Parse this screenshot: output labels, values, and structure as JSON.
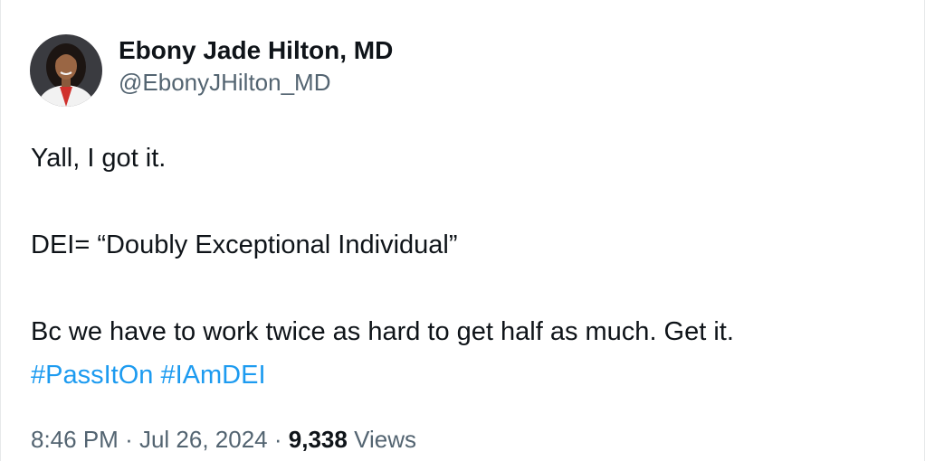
{
  "author": {
    "display_name": "Ebony Jade Hilton, MD",
    "handle": "@EbonyJHilton_MD"
  },
  "tweet": {
    "lines": [
      "Yall, I got it.",
      "DEI= “Doubly Exceptional Individual”",
      "Bc we have to work twice as hard to get half as much. Get it."
    ],
    "hashtags": [
      "#PassItOn",
      "#IAmDEI"
    ]
  },
  "meta": {
    "time": "8:46 PM",
    "separator": "·",
    "date": "Jul 26, 2024",
    "views_count": "9,338",
    "views_label": "Views"
  },
  "colors": {
    "link": "#1d9bf0",
    "secondary_text": "#536471",
    "primary_text": "#0f1419"
  }
}
